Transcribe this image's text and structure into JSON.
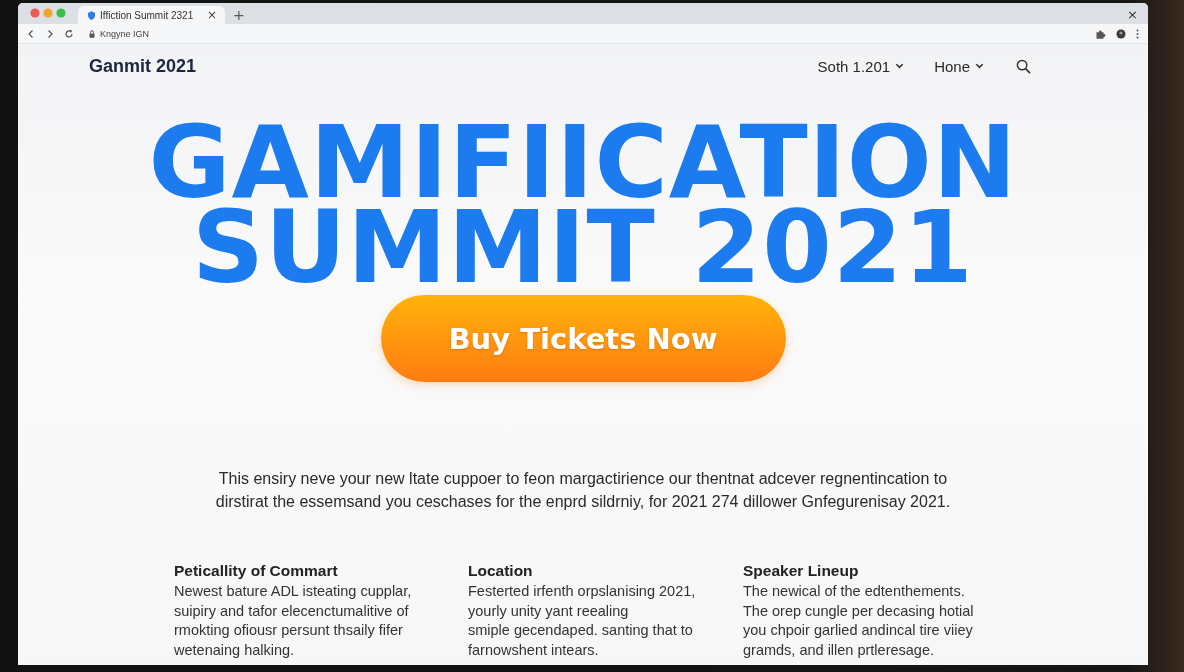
{
  "browser": {
    "tab": {
      "title": "Iffiction Summit 2321",
      "close": "×"
    },
    "new_tab": "+",
    "window_close": "×",
    "address": "Kngyne IGN"
  },
  "header": {
    "logo": "Ganmit 2021",
    "nav": [
      {
        "label": "Soth 1.201"
      },
      {
        "label": "Hone"
      }
    ]
  },
  "hero": {
    "title": [
      "GAMIFIICATION",
      "SUMMIT 2021"
    ],
    "button": "Buy Tickets Now"
  },
  "intro": "This ensiry neve your new ltate cuppoer to feon margactirience our thentnat adcever regnentincation to\ndirstirat the essemsand you ceschases for the enprd sildrniy, for 2021 274 dillower Gnfegurenisay 2021.",
  "features": [
    {
      "heading": "Peticallity of Commart",
      "text": "Newest bature ADL isteating cupplar,\nsuipiry and tafor elecenctumalitive of\nrmokting ofiousr persunt thsaily fifer\nwetenaing halking."
    },
    {
      "heading": "Location",
      "text": "Festerted irfenth orpslanising 2021,\nyourly unity yant reealing\nsmiple gecendaped. santing that to\nfarnowshent intears."
    },
    {
      "heading": "Speaker Lineup",
      "text": "The newical of the edtenthements.\nThe orep cungle per decasing hotial\nyou chpoir garlied andincal tire viiey\ngramds, and illen prtleresage."
    }
  ]
}
